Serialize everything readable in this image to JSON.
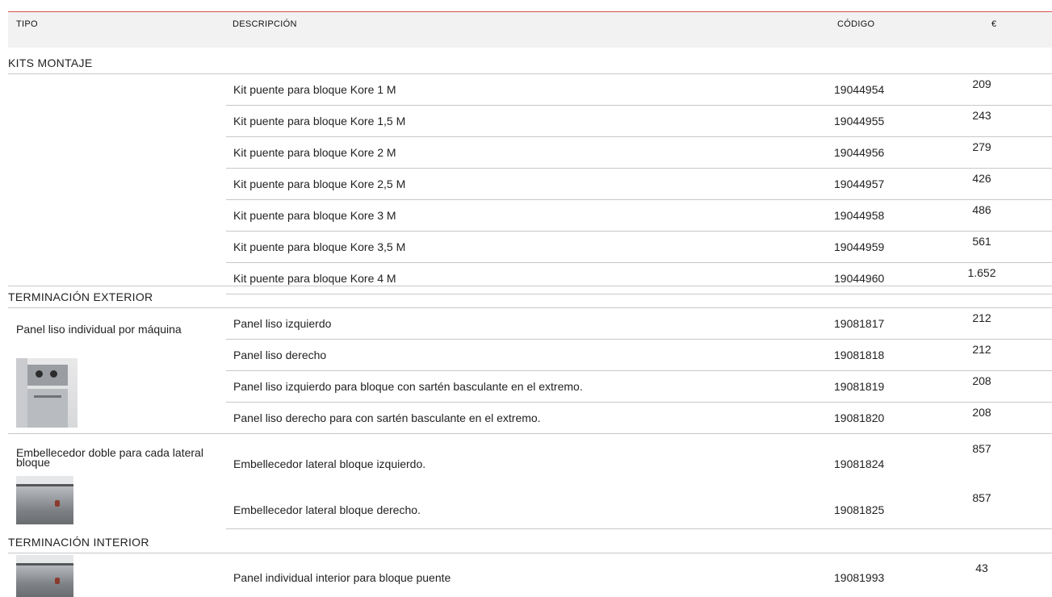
{
  "header": {
    "tipo": "TIPO",
    "descripcion": "DESCRIPCIÓN",
    "codigo": "CÓDIGO",
    "precio": "€"
  },
  "sections": {
    "kits": "KITS MONTAJE",
    "exterior": "TERMINACIÓN EXTERIOR",
    "interior": "TERMINACIÓN  INTERIOR"
  },
  "groups": {
    "panel_liso": "Panel liso individual por máquina",
    "embellecedor": "Embellecedor doble para cada lateral bloque"
  },
  "rows": [
    {
      "desc": "Kit puente para bloque Kore 1 M",
      "code": "19044954",
      "price": "209"
    },
    {
      "desc": "Kit puente para bloque Kore 1,5 M",
      "code": "19044955",
      "price": "243"
    },
    {
      "desc": "Kit puente para bloque Kore 2 M",
      "code": "19044956",
      "price": "279"
    },
    {
      "desc": "Kit puente para bloque Kore 2,5 M",
      "code": "19044957",
      "price": "426"
    },
    {
      "desc": "Kit puente para bloque Kore 3 M",
      "code": "19044958",
      "price": "486"
    },
    {
      "desc": "Kit puente para bloque Kore 3,5 M",
      "code": "19044959",
      "price": "561"
    },
    {
      "desc": "Kit puente para bloque Kore 4 M",
      "code": "19044960",
      "price": "1.652"
    },
    {
      "desc": "Panel liso izquierdo",
      "code": "19081817",
      "price": "212"
    },
    {
      "desc": "Panel liso derecho",
      "code": "19081818",
      "price": "212"
    },
    {
      "desc": "Panel liso izquierdo para bloque con sartén basculante en el extremo.",
      "code": "19081819",
      "price": "208"
    },
    {
      "desc": "Panel liso derecho para con sartén basculante en el extremo.",
      "code": "19081820",
      "price": "208"
    },
    {
      "desc": "Embellecedor lateral bloque izquierdo.",
      "code": "19081824",
      "price": "857"
    },
    {
      "desc": "Embellecedor lateral bloque derecho.",
      "code": "19081825",
      "price": "857"
    },
    {
      "desc": "Panel individual interior para bloque puente",
      "code": "19081993",
      "price": "43"
    }
  ]
}
